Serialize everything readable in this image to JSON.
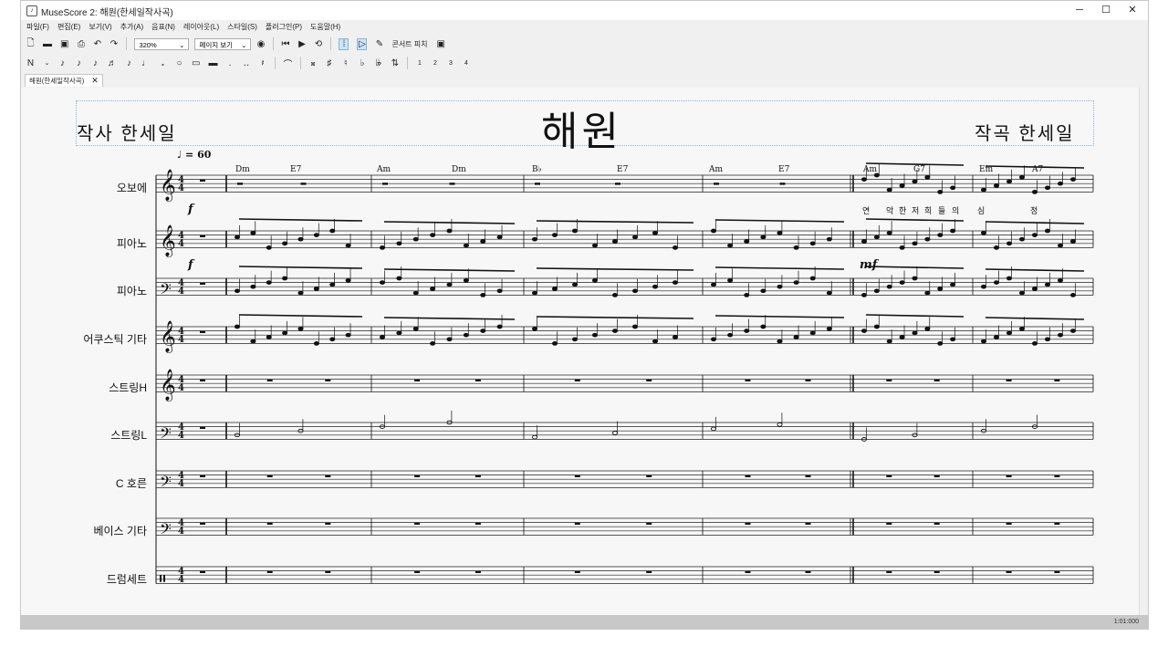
{
  "window": {
    "title": "MuseScore 2: 해원(한세일작사곡)",
    "controls": [
      "─",
      "☐",
      "✕"
    ]
  },
  "menu": [
    "파일(F)",
    "편집(E)",
    "보기(V)",
    "추가(A)",
    "음표(N)",
    "레이아웃(L)",
    "스타일(S)",
    "플러그인(P)",
    "도움말(H)"
  ],
  "toolbar": {
    "zoom": "320%",
    "view_mode": "페이지 보기",
    "concert_pitch": "콘서트 피치"
  },
  "note_toolbar": {
    "voices": [
      "1",
      "2",
      "3",
      "4"
    ]
  },
  "tab": {
    "label": "해원(한세일작사곡)",
    "close": "✕"
  },
  "score": {
    "title": "해원",
    "lyricist": "작사 한세일",
    "composer": "작곡 한세일",
    "tempo": "♩ = 60",
    "instruments": [
      "오보에",
      "피아노",
      "피아노",
      "어쿠스틱 기타",
      "스트링H",
      "스트링L",
      "C 호른",
      "베이스 기타",
      "드럼세트"
    ],
    "chords": [
      "Dm",
      "E7",
      "Am",
      "Dm",
      "B♭",
      "E7",
      "Am",
      "E7",
      "Am",
      "G7",
      "Em",
      "A7"
    ],
    "lyrics": [
      "연",
      "악",
      "한",
      "저",
      "희",
      "들",
      "의",
      "심",
      "정"
    ],
    "dynamics": [
      "f",
      "f",
      "mf"
    ],
    "time_signature": "4/4"
  },
  "status": {
    "time": "1:01:000"
  }
}
